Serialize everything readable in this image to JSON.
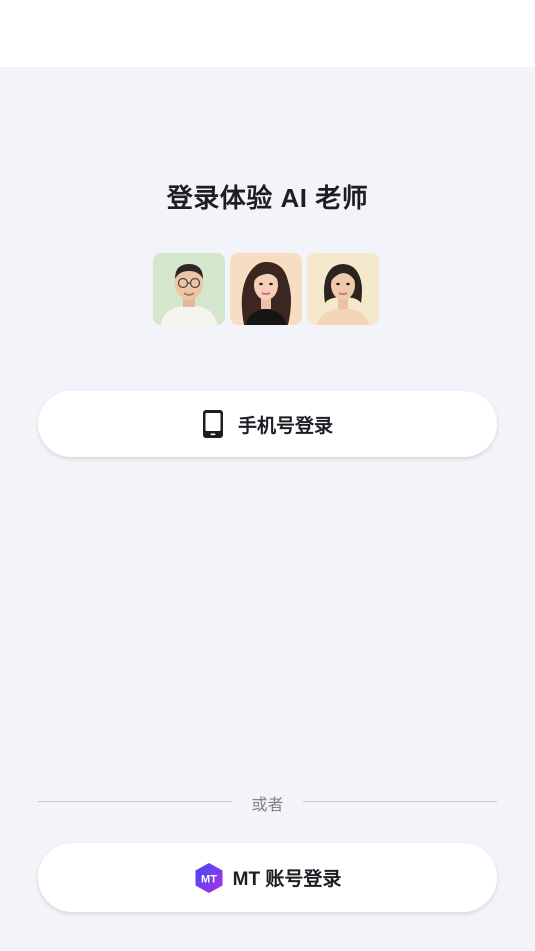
{
  "header": {
    "title": "登录体验 AI 老师"
  },
  "avatars": [
    {
      "icon": "teacher-avatar-1",
      "bg": "#d4e6cc"
    },
    {
      "icon": "teacher-avatar-2",
      "bg": "#f7ddc2"
    },
    {
      "icon": "teacher-avatar-3",
      "bg": "#f5e8cc"
    }
  ],
  "login": {
    "phone_label": "手机号登录",
    "phone_icon": "mobile-phone-icon",
    "or_text": "或者",
    "mt_label": "MT 账号登录",
    "mt_icon": "mt-logo-icon"
  },
  "colors": {
    "background": "#f3f4f9",
    "button_bg": "#ffffff",
    "text": "#1d1d24",
    "muted": "#80828a",
    "mt_gradient_start": "#3a4cf5",
    "mt_gradient_end": "#b22ee8"
  }
}
